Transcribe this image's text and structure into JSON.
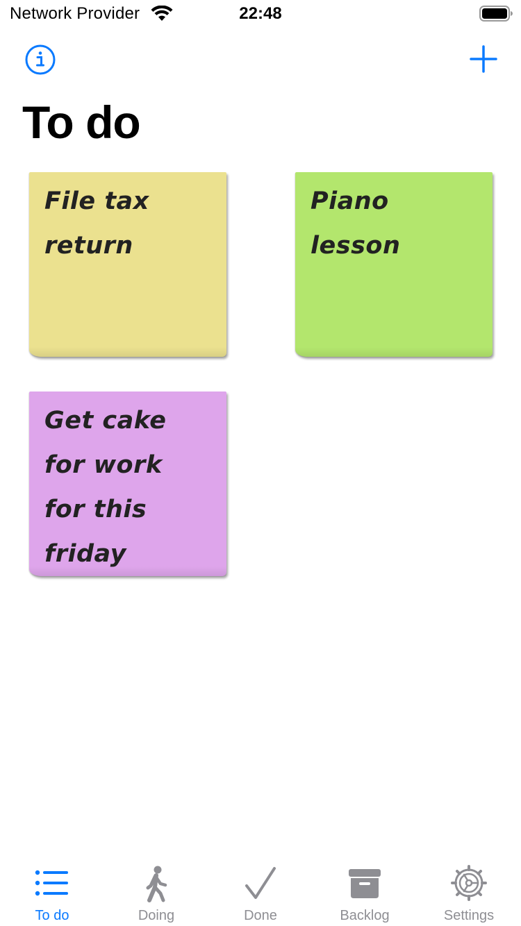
{
  "status_bar": {
    "carrier": "Network Provider",
    "time": "22:48",
    "icons": [
      "wifi-icon",
      "battery-icon"
    ]
  },
  "nav": {
    "info_icon": "info-circle-icon",
    "add_icon": "plus-icon",
    "accent_color": "#0a7aff"
  },
  "page": {
    "title": "To do"
  },
  "notes": [
    {
      "text": "File tax return",
      "color": "#ebe18f"
    },
    {
      "text": "Piano lesson",
      "color": "#b3e66d"
    },
    {
      "text": "Get cake for work for this friday",
      "color": "#dea5eb"
    }
  ],
  "tab_bar": {
    "selected": "To do",
    "tabs": [
      {
        "label": "To do",
        "icon": "list-icon"
      },
      {
        "label": "Doing",
        "icon": "walking-person-icon"
      },
      {
        "label": "Done",
        "icon": "checkmark-icon"
      },
      {
        "label": "Backlog",
        "icon": "archive-box-icon"
      },
      {
        "label": "Settings",
        "icon": "gear-icon"
      }
    ]
  }
}
